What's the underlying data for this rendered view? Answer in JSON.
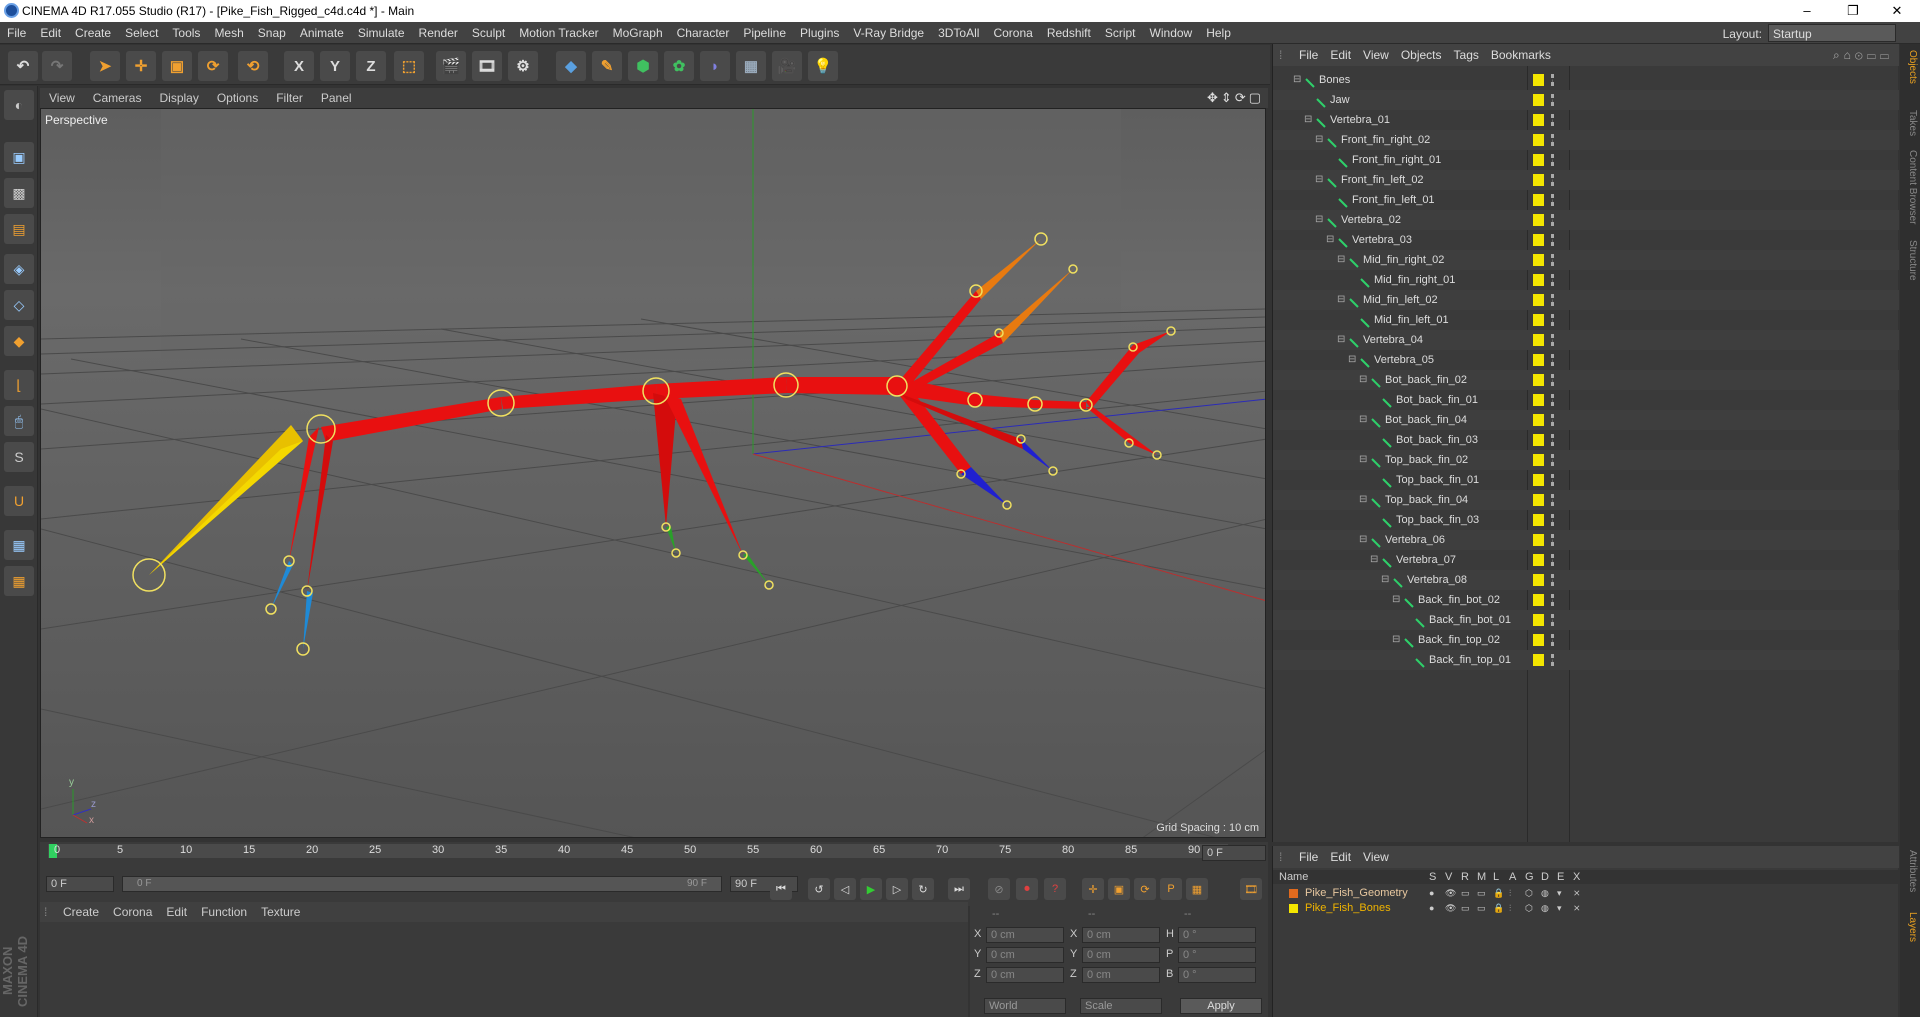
{
  "window": {
    "title": "CINEMA 4D R17.055 Studio (R17) - [Pike_Fish_Rigged_c4d.c4d *] - Main",
    "minimize": "–",
    "restore": "❐",
    "close": "✕"
  },
  "menu": [
    "File",
    "Edit",
    "Create",
    "Select",
    "Tools",
    "Mesh",
    "Snap",
    "Animate",
    "Simulate",
    "Render",
    "Sculpt",
    "Motion Tracker",
    "MoGraph",
    "Character",
    "Pipeline",
    "Plugins",
    "V-Ray Bridge",
    "3DToAll",
    "Corona",
    "Redshift",
    "Script",
    "Window",
    "Help"
  ],
  "layout": {
    "label": "Layout:",
    "value": "Startup"
  },
  "toolbar": {
    "x": "X",
    "y": "Y",
    "z": "Z"
  },
  "viewport": {
    "menu": [
      "View",
      "Cameras",
      "Display",
      "Options",
      "Filter",
      "Panel"
    ],
    "label": "Perspective",
    "grid_spacing": "Grid Spacing : 10 cm",
    "axis_y": "y",
    "axis_z": "z",
    "axis_x": "x"
  },
  "objects": {
    "menu": [
      "File",
      "Edit",
      "View",
      "Objects",
      "Tags",
      "Bookmarks"
    ],
    "items": [
      {
        "name": "Bones",
        "depth": 0
      },
      {
        "name": "Jaw",
        "depth": 1
      },
      {
        "name": "Vertebra_01",
        "depth": 1
      },
      {
        "name": "Front_fin_right_02",
        "depth": 2
      },
      {
        "name": "Front_fin_right_01",
        "depth": 3
      },
      {
        "name": "Front_fin_left_02",
        "depth": 2
      },
      {
        "name": "Front_fin_left_01",
        "depth": 3
      },
      {
        "name": "Vertebra_02",
        "depth": 2
      },
      {
        "name": "Vertebra_03",
        "depth": 3
      },
      {
        "name": "Mid_fin_right_02",
        "depth": 4
      },
      {
        "name": "Mid_fin_right_01",
        "depth": 5
      },
      {
        "name": "Mid_fin_left_02",
        "depth": 4
      },
      {
        "name": "Mid_fin_left_01",
        "depth": 5
      },
      {
        "name": "Vertebra_04",
        "depth": 4
      },
      {
        "name": "Vertebra_05",
        "depth": 5
      },
      {
        "name": "Bot_back_fin_02",
        "depth": 6
      },
      {
        "name": "Bot_back_fin_01",
        "depth": 7
      },
      {
        "name": "Bot_back_fin_04",
        "depth": 6
      },
      {
        "name": "Bot_back_fin_03",
        "depth": 7
      },
      {
        "name": "Top_back_fin_02",
        "depth": 6
      },
      {
        "name": "Top_back_fin_01",
        "depth": 7
      },
      {
        "name": "Top_back_fin_04",
        "depth": 6
      },
      {
        "name": "Top_back_fin_03",
        "depth": 7
      },
      {
        "name": "Vertebra_06",
        "depth": 6
      },
      {
        "name": "Vertebra_07",
        "depth": 7
      },
      {
        "name": "Vertebra_08",
        "depth": 8
      },
      {
        "name": "Back_fin_bot_02",
        "depth": 9
      },
      {
        "name": "Back_fin_bot_01",
        "depth": 10
      },
      {
        "name": "Back_fin_top_02",
        "depth": 9
      },
      {
        "name": "Back_fin_top_01",
        "depth": 10
      }
    ]
  },
  "side_tabs": [
    "Objects",
    "Takes",
    "Content Browser",
    "Structure",
    "Attributes",
    "Layers"
  ],
  "timeline": {
    "ticks": [
      "0",
      "5",
      "10",
      "15",
      "20",
      "25",
      "30",
      "35",
      "40",
      "45",
      "50",
      "55",
      "60",
      "65",
      "70",
      "75",
      "80",
      "85",
      "90"
    ],
    "current_frame": "0 F",
    "start": "0 F",
    "range_start": "0 F",
    "range_end": "90 F",
    "end": "90 F"
  },
  "materials": {
    "menu": [
      "Create",
      "Corona",
      "Edit",
      "Function",
      "Texture"
    ]
  },
  "coords": {
    "headers": [
      "--",
      "--",
      "--"
    ],
    "rows": [
      {
        "a": "X",
        "av": "0 cm",
        "b": "X",
        "bv": "0 cm",
        "c": "H",
        "cv": "0 °"
      },
      {
        "a": "Y",
        "av": "0 cm",
        "b": "Y",
        "bv": "0 cm",
        "c": "P",
        "cv": "0 °"
      },
      {
        "a": "Z",
        "av": "0 cm",
        "b": "Z",
        "bv": "0 cm",
        "c": "B",
        "cv": "0 °"
      }
    ],
    "world": "World",
    "scale": "Scale",
    "apply": "Apply"
  },
  "layers": {
    "menu": [
      "File",
      "Edit",
      "View"
    ],
    "columns": [
      "Name",
      "S",
      "V",
      "R",
      "M",
      "L",
      "A",
      "G",
      "D",
      "E",
      "X"
    ],
    "items": [
      {
        "name": "Pike_Fish_Geometry",
        "color": "#e06a1e",
        "text_color": "#e8c8a0"
      },
      {
        "name": "Pike_Fish_Bones",
        "color": "#f4e600",
        "text_color": "#f0b400"
      }
    ]
  },
  "brand": "MAXON CINEMA 4D"
}
